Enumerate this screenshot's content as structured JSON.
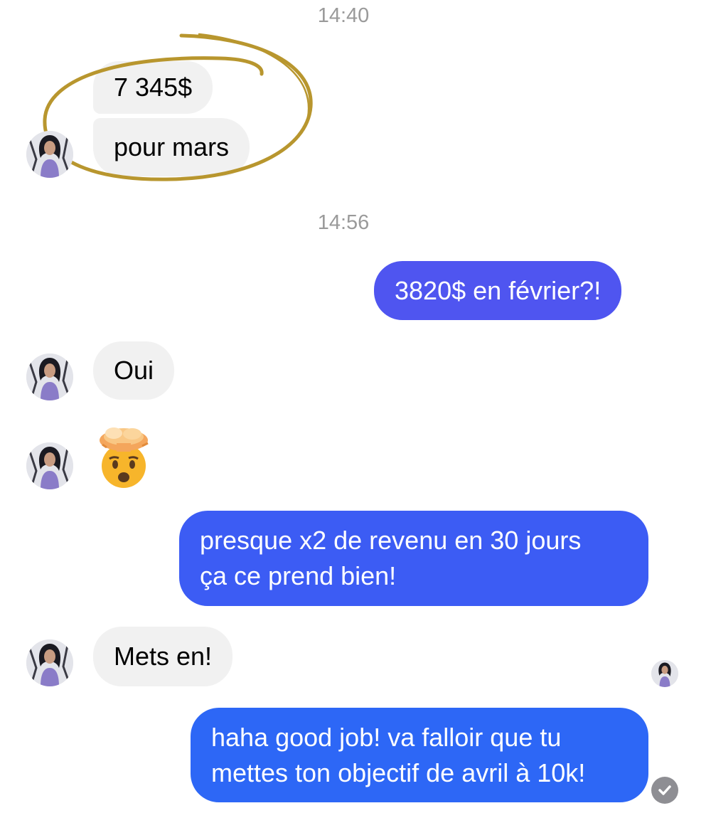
{
  "timestamps": {
    "first": "14:40",
    "second": "14:56"
  },
  "messages": [
    {
      "id": "m1",
      "side": "incoming",
      "text": "7 345$"
    },
    {
      "id": "m2",
      "side": "incoming",
      "text": "pour mars"
    },
    {
      "id": "m3",
      "side": "outgoing",
      "text": "3820$ en février?!",
      "color": "#4f55f0"
    },
    {
      "id": "m4",
      "side": "incoming",
      "text": "Oui"
    },
    {
      "id": "m5",
      "side": "incoming",
      "emoji": "exploding-head-icon"
    },
    {
      "id": "m6",
      "side": "outgoing",
      "lines": [
        "presque x2 de revenu en 30 jours",
        "ça ce prend bien!"
      ],
      "color": "#3c5cf4"
    },
    {
      "id": "m7",
      "side": "incoming",
      "text": "Mets en!"
    },
    {
      "id": "m8",
      "side": "outgoing",
      "lines": [
        "haha good job! va falloir que tu",
        "mettes ton objectif de avril à 10k!"
      ],
      "color": "#2d67f6"
    }
  ],
  "colors": {
    "incoming_bubble": "#f1f1f1",
    "annotation_circle": "#b8962e",
    "timestamp_text": "#9a9a9a"
  },
  "icons": [
    "contact-avatar",
    "exploding-head-icon",
    "seen-avatar-icon",
    "sent-check-icon"
  ]
}
